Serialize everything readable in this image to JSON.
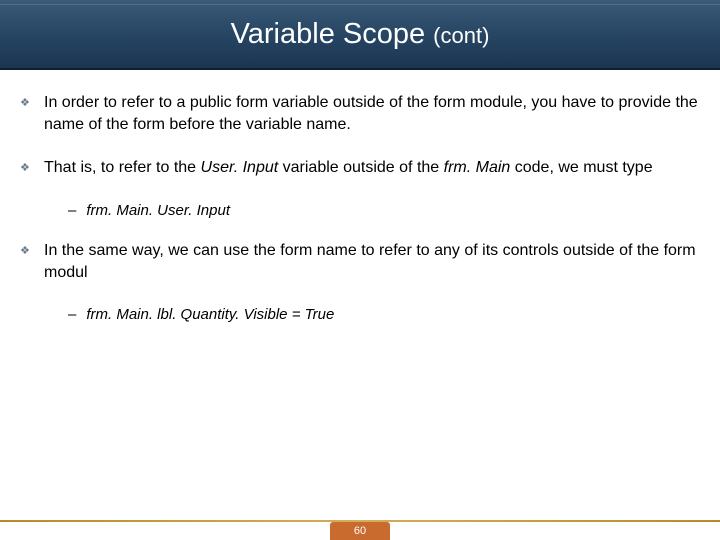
{
  "header": {
    "title_main": "Variable Scope ",
    "title_cont": "(cont)"
  },
  "bullets": [
    {
      "text": "In order to refer to a public form variable outside of the form module, you have to provide the name of the form before the variable name."
    },
    {
      "prefix": "That is, to refer to the ",
      "italic1": "User. Input",
      "mid": " variable outside of the ",
      "italic2": "frm. Main",
      "suffix": " code, we must type",
      "sub": "frm. Main. User. Input"
    },
    {
      "text": "In the same way, we can use the form name to refer to any of its controls outside of the form modul",
      "sub": "frm. Main. lbl. Quantity. Visible = True"
    }
  ],
  "footer": {
    "page": "60"
  }
}
